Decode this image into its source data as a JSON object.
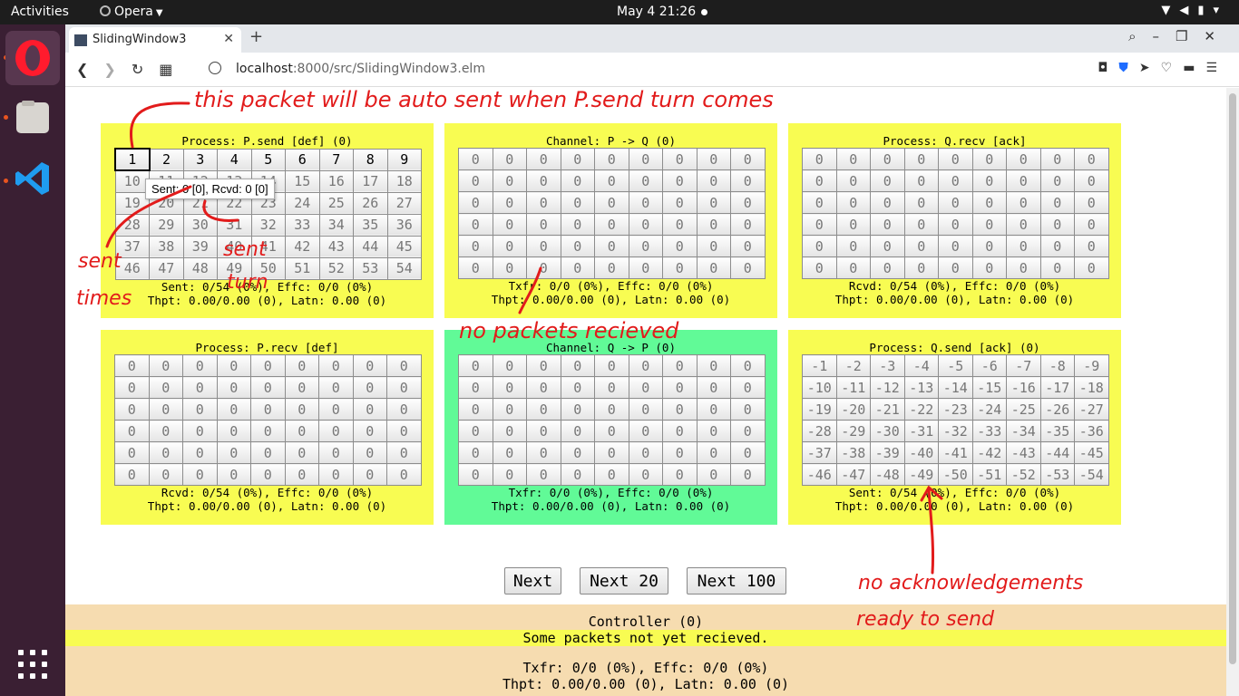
{
  "topbar": {
    "activities": "Activities",
    "app": "Opera",
    "clock": "May 4  21:26"
  },
  "browser": {
    "tab_title": "SlidingWindow3",
    "url_host": "localhost",
    "url_rest": ":8000/src/SlidingWindow3.elm"
  },
  "panels": [
    {
      "title": "Process: P.send [def] (0)",
      "stat1": "Sent: 0/54 (0%), Effc: 0/0 (0%)",
      "stat2": "Thpt: 0.00/0.00 (0), Latn: 0.00 (0)",
      "cells": [
        [
          "1",
          "2",
          "3",
          "4",
          "5",
          "6",
          "7",
          "8",
          "9"
        ],
        [
          "10",
          "11",
          "12",
          "13",
          "14",
          "15",
          "16",
          "17",
          "18"
        ],
        [
          "19",
          "20",
          "21",
          "22",
          "23",
          "24",
          "25",
          "26",
          "27"
        ],
        [
          "28",
          "29",
          "30",
          "31",
          "32",
          "33",
          "34",
          "35",
          "36"
        ],
        [
          "37",
          "38",
          "39",
          "40",
          "41",
          "42",
          "43",
          "44",
          "45"
        ],
        [
          "46",
          "47",
          "48",
          "49",
          "50",
          "51",
          "52",
          "53",
          "54"
        ]
      ]
    },
    {
      "title": "Channel: P -> Q (0)",
      "stat1": "Txfr: 0/0 (0%), Effc: 0/0 (0%)",
      "stat2": "Thpt: 0.00/0.00 (0), Latn: 0.00 (0)",
      "cells": [
        [
          "0",
          "0",
          "0",
          "0",
          "0",
          "0",
          "0",
          "0",
          "0"
        ],
        [
          "0",
          "0",
          "0",
          "0",
          "0",
          "0",
          "0",
          "0",
          "0"
        ],
        [
          "0",
          "0",
          "0",
          "0",
          "0",
          "0",
          "0",
          "0",
          "0"
        ],
        [
          "0",
          "0",
          "0",
          "0",
          "0",
          "0",
          "0",
          "0",
          "0"
        ],
        [
          "0",
          "0",
          "0",
          "0",
          "0",
          "0",
          "0",
          "0",
          "0"
        ],
        [
          "0",
          "0",
          "0",
          "0",
          "0",
          "0",
          "0",
          "0",
          "0"
        ]
      ]
    },
    {
      "title": "Process: Q.recv [ack]",
      "stat1": "Rcvd: 0/54 (0%), Effc: 0/0 (0%)",
      "stat2": "Thpt: 0.00/0.00 (0), Latn: 0.00 (0)",
      "cells": [
        [
          "0",
          "0",
          "0",
          "0",
          "0",
          "0",
          "0",
          "0",
          "0"
        ],
        [
          "0",
          "0",
          "0",
          "0",
          "0",
          "0",
          "0",
          "0",
          "0"
        ],
        [
          "0",
          "0",
          "0",
          "0",
          "0",
          "0",
          "0",
          "0",
          "0"
        ],
        [
          "0",
          "0",
          "0",
          "0",
          "0",
          "0",
          "0",
          "0",
          "0"
        ],
        [
          "0",
          "0",
          "0",
          "0",
          "0",
          "0",
          "0",
          "0",
          "0"
        ],
        [
          "0",
          "0",
          "0",
          "0",
          "0",
          "0",
          "0",
          "0",
          "0"
        ]
      ]
    },
    {
      "title": "Process: P.recv [def]",
      "stat1": "Rcvd: 0/54 (0%), Effc: 0/0 (0%)",
      "stat2": "Thpt: 0.00/0.00 (0), Latn: 0.00 (0)",
      "cells": [
        [
          "0",
          "0",
          "0",
          "0",
          "0",
          "0",
          "0",
          "0",
          "0"
        ],
        [
          "0",
          "0",
          "0",
          "0",
          "0",
          "0",
          "0",
          "0",
          "0"
        ],
        [
          "0",
          "0",
          "0",
          "0",
          "0",
          "0",
          "0",
          "0",
          "0"
        ],
        [
          "0",
          "0",
          "0",
          "0",
          "0",
          "0",
          "0",
          "0",
          "0"
        ],
        [
          "0",
          "0",
          "0",
          "0",
          "0",
          "0",
          "0",
          "0",
          "0"
        ],
        [
          "0",
          "0",
          "0",
          "0",
          "0",
          "0",
          "0",
          "0",
          "0"
        ]
      ]
    },
    {
      "title": "Channel: Q -> P (0)",
      "stat1": "Txfr: 0/0 (0%), Effc: 0/0 (0%)",
      "stat2": "Thpt: 0.00/0.00 (0), Latn: 0.00 (0)",
      "cells": [
        [
          "0",
          "0",
          "0",
          "0",
          "0",
          "0",
          "0",
          "0",
          "0"
        ],
        [
          "0",
          "0",
          "0",
          "0",
          "0",
          "0",
          "0",
          "0",
          "0"
        ],
        [
          "0",
          "0",
          "0",
          "0",
          "0",
          "0",
          "0",
          "0",
          "0"
        ],
        [
          "0",
          "0",
          "0",
          "0",
          "0",
          "0",
          "0",
          "0",
          "0"
        ],
        [
          "0",
          "0",
          "0",
          "0",
          "0",
          "0",
          "0",
          "0",
          "0"
        ],
        [
          "0",
          "0",
          "0",
          "0",
          "0",
          "0",
          "0",
          "0",
          "0"
        ]
      ]
    },
    {
      "title": "Process: Q.send [ack] (0)",
      "stat1": "Sent: 0/54 (0%), Effc: 0/0 (0%)",
      "stat2": "Thpt: 0.00/0.00 (0), Latn: 0.00 (0)",
      "cells": [
        [
          "-1",
          "-2",
          "-3",
          "-4",
          "-5",
          "-6",
          "-7",
          "-8",
          "-9"
        ],
        [
          "-10",
          "-11",
          "-12",
          "-13",
          "-14",
          "-15",
          "-16",
          "-17",
          "-18"
        ],
        [
          "-19",
          "-20",
          "-21",
          "-22",
          "-23",
          "-24",
          "-25",
          "-26",
          "-27"
        ],
        [
          "-28",
          "-29",
          "-30",
          "-31",
          "-32",
          "-33",
          "-34",
          "-35",
          "-36"
        ],
        [
          "-37",
          "-38",
          "-39",
          "-40",
          "-41",
          "-42",
          "-43",
          "-44",
          "-45"
        ],
        [
          "-46",
          "-47",
          "-48",
          "-49",
          "-50",
          "-51",
          "-52",
          "-53",
          "-54"
        ]
      ]
    }
  ],
  "buttons": {
    "next": "Next",
    "next20": "Next 20",
    "next100": "Next 100"
  },
  "controller": {
    "title": "Controller (0)",
    "warning": "Some packets not yet recieved.",
    "stat1": "Txfr: 0/0 (0%), Effc: 0/0 (0%)",
    "stat2": "Thpt: 0.00/0.00 (0), Latn: 0.00 (0)"
  },
  "tooltip": "Sent: 0 [0], Rcvd: 0 [0]",
  "annotations": {
    "auto_sent": "this packet will be auto sent when P.send turn comes",
    "sent_times_1": "sent",
    "sent_times_2": "times",
    "sent_turn_1": "sent",
    "sent_turn_2": "turn",
    "no_packets": "no packets recieved",
    "no_acks_1": "no acknowledgements",
    "no_acks_2": "ready to send"
  },
  "colors": {
    "panel_yellow": "#f8fc52",
    "panel_green": "#61fa97",
    "controller_bg": "#f6dcb0",
    "annotation_red": "#e21b1b"
  }
}
